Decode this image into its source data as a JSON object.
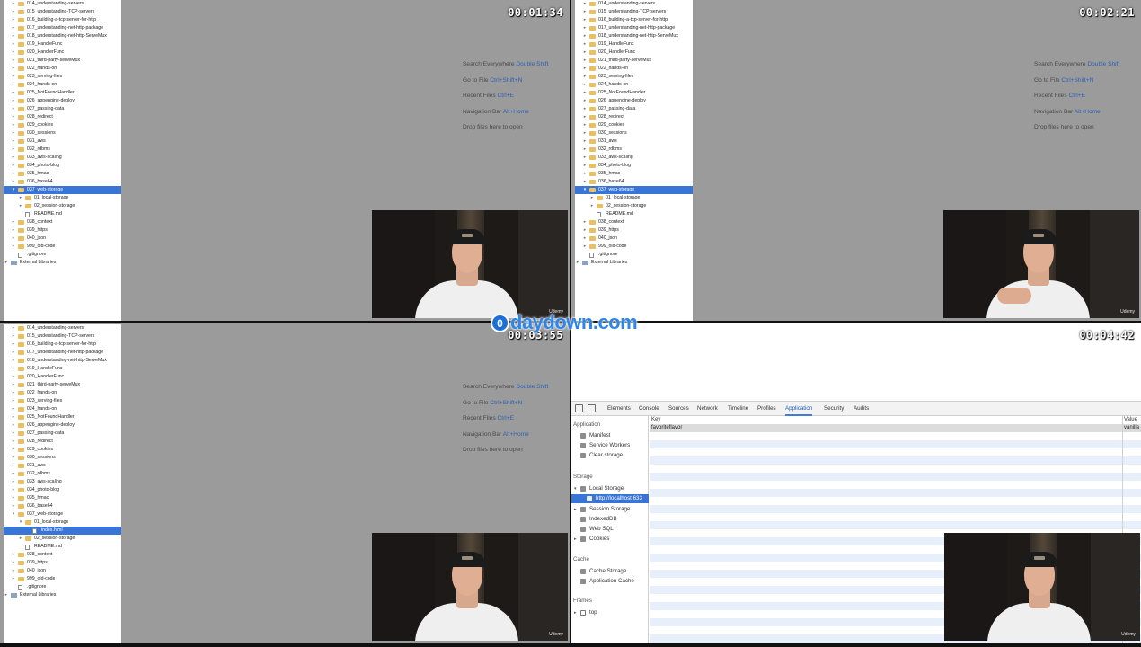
{
  "watermark": {
    "badge": "0",
    "text": "daydown.com"
  },
  "brand_label": "Udemy",
  "panels": [
    {
      "timestamp": "00:01:34",
      "tree": [
        {
          "label": "014_understanding-servers",
          "depth": 1,
          "type": "folder",
          "arrow": "▸"
        },
        {
          "label": "015_understanding-TCP-servers",
          "depth": 1,
          "type": "folder",
          "arrow": "▸"
        },
        {
          "label": "016_building-a-tcp-server-for-http",
          "depth": 1,
          "type": "folder",
          "arrow": "▸"
        },
        {
          "label": "017_understanding-net-http-package",
          "depth": 1,
          "type": "folder",
          "arrow": "▸"
        },
        {
          "label": "018_understanding-net-http-ServeMux",
          "depth": 1,
          "type": "folder",
          "arrow": "▸"
        },
        {
          "label": "019_HandleFunc",
          "depth": 1,
          "type": "folder",
          "arrow": "▸"
        },
        {
          "label": "020_HandlerFunc",
          "depth": 1,
          "type": "folder",
          "arrow": "▸"
        },
        {
          "label": "021_third-party-serveMux",
          "depth": 1,
          "type": "folder",
          "arrow": "▸"
        },
        {
          "label": "022_hands-on",
          "depth": 1,
          "type": "folder",
          "arrow": "▸"
        },
        {
          "label": "023_serving-files",
          "depth": 1,
          "type": "folder",
          "arrow": "▸"
        },
        {
          "label": "024_hands-on",
          "depth": 1,
          "type": "folder",
          "arrow": "▸"
        },
        {
          "label": "025_NotFoundHandler",
          "depth": 1,
          "type": "folder",
          "arrow": "▸"
        },
        {
          "label": "026_appengine-deploy",
          "depth": 1,
          "type": "folder",
          "arrow": "▸"
        },
        {
          "label": "027_passing-data",
          "depth": 1,
          "type": "folder",
          "arrow": "▸"
        },
        {
          "label": "028_redirect",
          "depth": 1,
          "type": "folder",
          "arrow": "▸"
        },
        {
          "label": "029_cookies",
          "depth": 1,
          "type": "folder",
          "arrow": "▸"
        },
        {
          "label": "030_sessions",
          "depth": 1,
          "type": "folder",
          "arrow": "▸"
        },
        {
          "label": "031_aws",
          "depth": 1,
          "type": "folder",
          "arrow": "▸"
        },
        {
          "label": "032_rdbms",
          "depth": 1,
          "type": "folder",
          "arrow": "▸"
        },
        {
          "label": "033_aws-scaling",
          "depth": 1,
          "type": "folder",
          "arrow": "▸"
        },
        {
          "label": "034_photo-blog",
          "depth": 1,
          "type": "folder",
          "arrow": "▸"
        },
        {
          "label": "035_hmac",
          "depth": 1,
          "type": "folder",
          "arrow": "▸"
        },
        {
          "label": "036_base64",
          "depth": 1,
          "type": "folder",
          "arrow": "▸"
        },
        {
          "label": "037_web-storage",
          "depth": 1,
          "type": "folder",
          "arrow": "▾",
          "selected": true
        },
        {
          "label": "01_local-storage",
          "depth": 2,
          "type": "folder",
          "arrow": "▸"
        },
        {
          "label": "02_session-storage",
          "depth": 2,
          "type": "folder",
          "arrow": "▸"
        },
        {
          "label": "README.md",
          "depth": 2,
          "type": "file",
          "arrow": ""
        },
        {
          "label": "038_context",
          "depth": 1,
          "type": "folder",
          "arrow": "▸"
        },
        {
          "label": "039_https",
          "depth": 1,
          "type": "folder",
          "arrow": "▸"
        },
        {
          "label": "040_json",
          "depth": 1,
          "type": "folder",
          "arrow": "▸"
        },
        {
          "label": "999_old-code",
          "depth": 1,
          "type": "folder",
          "arrow": "▸"
        },
        {
          "label": ".gitignore",
          "depth": 1,
          "type": "file",
          "arrow": ""
        },
        {
          "label": "External Libraries",
          "depth": 0,
          "type": "lib",
          "arrow": "▸"
        }
      ]
    },
    {
      "timestamp": "00:02:21",
      "tree": [
        {
          "label": "014_understanding-servers",
          "depth": 1,
          "type": "folder",
          "arrow": "▸"
        },
        {
          "label": "015_understanding-TCP-servers",
          "depth": 1,
          "type": "folder",
          "arrow": "▸"
        },
        {
          "label": "016_building-a-tcp-server-for-http",
          "depth": 1,
          "type": "folder",
          "arrow": "▸"
        },
        {
          "label": "017_understanding-net-http-package",
          "depth": 1,
          "type": "folder",
          "arrow": "▸"
        },
        {
          "label": "018_understanding-net-http-ServeMux",
          "depth": 1,
          "type": "folder",
          "arrow": "▸"
        },
        {
          "label": "019_HandleFunc",
          "depth": 1,
          "type": "folder",
          "arrow": "▸"
        },
        {
          "label": "020_HandlerFunc",
          "depth": 1,
          "type": "folder",
          "arrow": "▸"
        },
        {
          "label": "021_third-party-serveMux",
          "depth": 1,
          "type": "folder",
          "arrow": "▸"
        },
        {
          "label": "022_hands-on",
          "depth": 1,
          "type": "folder",
          "arrow": "▸"
        },
        {
          "label": "023_serving-files",
          "depth": 1,
          "type": "folder",
          "arrow": "▸"
        },
        {
          "label": "024_hands-on",
          "depth": 1,
          "type": "folder",
          "arrow": "▸"
        },
        {
          "label": "025_NotFoundHandler",
          "depth": 1,
          "type": "folder",
          "arrow": "▸"
        },
        {
          "label": "026_appengine-deploy",
          "depth": 1,
          "type": "folder",
          "arrow": "▸"
        },
        {
          "label": "027_passing-data",
          "depth": 1,
          "type": "folder",
          "arrow": "▸"
        },
        {
          "label": "028_redirect",
          "depth": 1,
          "type": "folder",
          "arrow": "▸"
        },
        {
          "label": "029_cookies",
          "depth": 1,
          "type": "folder",
          "arrow": "▸"
        },
        {
          "label": "030_sessions",
          "depth": 1,
          "type": "folder",
          "arrow": "▸"
        },
        {
          "label": "031_aws",
          "depth": 1,
          "type": "folder",
          "arrow": "▸"
        },
        {
          "label": "032_rdbms",
          "depth": 1,
          "type": "folder",
          "arrow": "▸"
        },
        {
          "label": "033_aws-scaling",
          "depth": 1,
          "type": "folder",
          "arrow": "▸"
        },
        {
          "label": "034_photo-blog",
          "depth": 1,
          "type": "folder",
          "arrow": "▸"
        },
        {
          "label": "035_hmac",
          "depth": 1,
          "type": "folder",
          "arrow": "▸"
        },
        {
          "label": "036_base64",
          "depth": 1,
          "type": "folder",
          "arrow": "▸"
        },
        {
          "label": "037_web-storage",
          "depth": 1,
          "type": "folder",
          "arrow": "▾",
          "selected": true
        },
        {
          "label": "01_local-storage",
          "depth": 2,
          "type": "folder",
          "arrow": "▸"
        },
        {
          "label": "02_session-storage",
          "depth": 2,
          "type": "folder",
          "arrow": "▸"
        },
        {
          "label": "README.md",
          "depth": 2,
          "type": "file",
          "arrow": ""
        },
        {
          "label": "038_context",
          "depth": 1,
          "type": "folder",
          "arrow": "▸"
        },
        {
          "label": "039_https",
          "depth": 1,
          "type": "folder",
          "arrow": "▸"
        },
        {
          "label": "040_json",
          "depth": 1,
          "type": "folder",
          "arrow": "▸"
        },
        {
          "label": "999_old-code",
          "depth": 1,
          "type": "folder",
          "arrow": "▸"
        },
        {
          "label": ".gitignore",
          "depth": 1,
          "type": "file",
          "arrow": ""
        },
        {
          "label": "External Libraries",
          "depth": 0,
          "type": "lib",
          "arrow": "▸"
        }
      ]
    },
    {
      "timestamp": "00:03:55",
      "tree": [
        {
          "label": "014_understanding-servers",
          "depth": 1,
          "type": "folder",
          "arrow": "▸"
        },
        {
          "label": "015_understanding-TCP-servers",
          "depth": 1,
          "type": "folder",
          "arrow": "▸"
        },
        {
          "label": "016_building-a-tcp-server-for-http",
          "depth": 1,
          "type": "folder",
          "arrow": "▸"
        },
        {
          "label": "017_understanding-net-http-package",
          "depth": 1,
          "type": "folder",
          "arrow": "▸"
        },
        {
          "label": "018_understanding-net-http-ServeMux",
          "depth": 1,
          "type": "folder",
          "arrow": "▸"
        },
        {
          "label": "019_HandleFunc",
          "depth": 1,
          "type": "folder",
          "arrow": "▸"
        },
        {
          "label": "020_HandlerFunc",
          "depth": 1,
          "type": "folder",
          "arrow": "▸"
        },
        {
          "label": "021_third-party-serveMux",
          "depth": 1,
          "type": "folder",
          "arrow": "▸"
        },
        {
          "label": "022_hands-on",
          "depth": 1,
          "type": "folder",
          "arrow": "▸"
        },
        {
          "label": "023_serving-files",
          "depth": 1,
          "type": "folder",
          "arrow": "▸"
        },
        {
          "label": "024_hands-on",
          "depth": 1,
          "type": "folder",
          "arrow": "▸"
        },
        {
          "label": "025_NotFoundHandler",
          "depth": 1,
          "type": "folder",
          "arrow": "▸"
        },
        {
          "label": "026_appengine-deploy",
          "depth": 1,
          "type": "folder",
          "arrow": "▸"
        },
        {
          "label": "027_passing-data",
          "depth": 1,
          "type": "folder",
          "arrow": "▸"
        },
        {
          "label": "028_redirect",
          "depth": 1,
          "type": "folder",
          "arrow": "▸"
        },
        {
          "label": "029_cookies",
          "depth": 1,
          "type": "folder",
          "arrow": "▸"
        },
        {
          "label": "030_sessions",
          "depth": 1,
          "type": "folder",
          "arrow": "▸"
        },
        {
          "label": "031_aws",
          "depth": 1,
          "type": "folder",
          "arrow": "▸"
        },
        {
          "label": "032_rdbms",
          "depth": 1,
          "type": "folder",
          "arrow": "▸"
        },
        {
          "label": "033_aws-scaling",
          "depth": 1,
          "type": "folder",
          "arrow": "▸"
        },
        {
          "label": "034_photo-blog",
          "depth": 1,
          "type": "folder",
          "arrow": "▸"
        },
        {
          "label": "035_hmac",
          "depth": 1,
          "type": "folder",
          "arrow": "▸"
        },
        {
          "label": "036_base64",
          "depth": 1,
          "type": "folder",
          "arrow": "▸"
        },
        {
          "label": "037_web-storage",
          "depth": 1,
          "type": "folder",
          "arrow": "▾"
        },
        {
          "label": "01_local-storage",
          "depth": 2,
          "type": "folder",
          "arrow": "▾"
        },
        {
          "label": "index.html",
          "depth": 3,
          "type": "file",
          "arrow": "",
          "selected": true
        },
        {
          "label": "02_session-storage",
          "depth": 2,
          "type": "folder",
          "arrow": "▸"
        },
        {
          "label": "README.md",
          "depth": 2,
          "type": "file",
          "arrow": ""
        },
        {
          "label": "038_context",
          "depth": 1,
          "type": "folder",
          "arrow": "▸"
        },
        {
          "label": "039_https",
          "depth": 1,
          "type": "folder",
          "arrow": "▸"
        },
        {
          "label": "040_json",
          "depth": 1,
          "type": "folder",
          "arrow": "▸"
        },
        {
          "label": "999_old-code",
          "depth": 1,
          "type": "folder",
          "arrow": "▸"
        },
        {
          "label": ".gitignore",
          "depth": 1,
          "type": "file",
          "arrow": ""
        },
        {
          "label": "External Libraries",
          "depth": 0,
          "type": "lib",
          "arrow": "▸"
        }
      ]
    },
    {
      "timestamp": "00:04:42"
    }
  ],
  "editor_hints": [
    {
      "text": "Search Everywhere ",
      "key": "Double Shift"
    },
    {
      "text": "Go to File ",
      "key": "Ctrl+Shift+N"
    },
    {
      "text": "Recent Files ",
      "key": "Ctrl+E"
    },
    {
      "text": "Navigation Bar ",
      "key": "Alt+Home"
    },
    {
      "text": "Drop files here to open",
      "key": ""
    }
  ],
  "devtools": {
    "tabs": [
      "Elements",
      "Console",
      "Sources",
      "Network",
      "Timeline",
      "Profiles",
      "Application",
      "Security",
      "Audits"
    ],
    "active_tab": "Application",
    "sidebar": {
      "application_label": "Application",
      "application_items": [
        "Manifest",
        "Service Workers",
        "Clear storage"
      ],
      "storage_label": "Storage",
      "local_storage": "Local Storage",
      "local_storage_child": "http://localhost:633",
      "storage_items": [
        "Session Storage",
        "IndexedDB",
        "Web SQL",
        "Cookies"
      ],
      "cache_label": "Cache",
      "cache_items": [
        "Cache Storage",
        "Application Cache"
      ],
      "frames_label": "Frames",
      "frames_item": "top"
    },
    "table": {
      "col_key": "Key",
      "col_value": "Value",
      "rows": [
        {
          "key": "favoriteflavor",
          "value": "vanilla"
        }
      ]
    }
  }
}
